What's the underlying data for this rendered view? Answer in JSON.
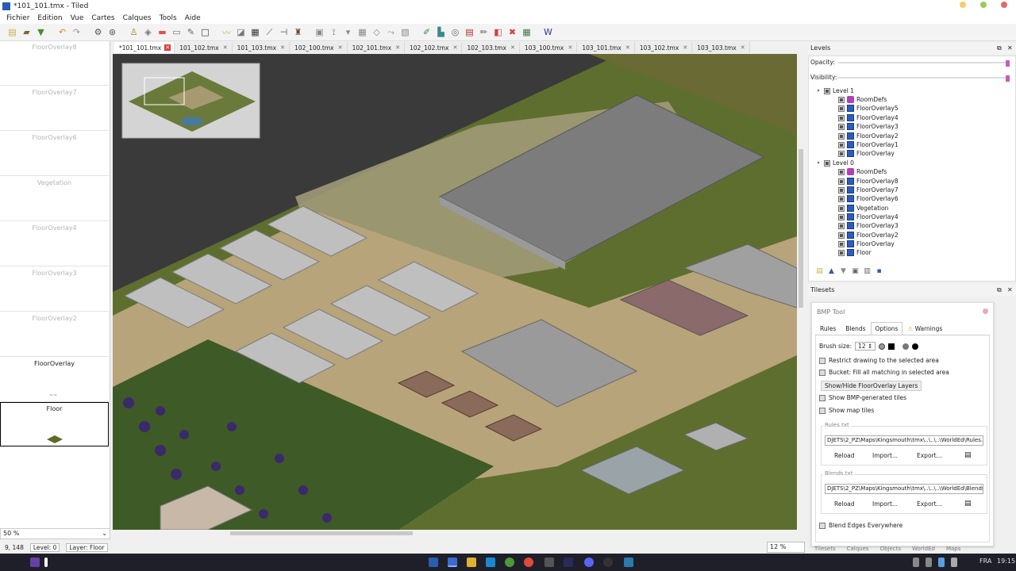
{
  "window": {
    "title": "*101_101.tmx - Tiled"
  },
  "menu": [
    "Fichier",
    "Edition",
    "Vue",
    "Cartes",
    "Calques",
    "Tools",
    "Aide"
  ],
  "left_panel": {
    "slots": [
      {
        "label": "FloorOverlay8"
      },
      {
        "label": "FloorOverlay7"
      },
      {
        "label": "FloorOverlay6"
      },
      {
        "label": "Vegetation"
      },
      {
        "label": "FloorOverlay4"
      },
      {
        "label": "FloorOverlay3"
      },
      {
        "label": "FloorOverlay2"
      },
      {
        "label": "FloorOverlay"
      },
      {
        "label": "Floor"
      }
    ],
    "zoom": "50 %"
  },
  "tabs": [
    {
      "label": "*101_101.tmx"
    },
    {
      "label": "101_102.tmx"
    },
    {
      "label": "101_103.tmx"
    },
    {
      "label": "102_100.tmx"
    },
    {
      "label": "102_101.tmx"
    },
    {
      "label": "102_102.tmx"
    },
    {
      "label": "102_103.tmx"
    },
    {
      "label": "103_100.tmx"
    },
    {
      "label": "103_101.tmx"
    },
    {
      "label": "103_102.tmx"
    },
    {
      "label": "103_103.tmx"
    }
  ],
  "status": {
    "coords": "9, 148",
    "level": "Level: 0",
    "layer": "Layer: Floor",
    "map_zoom": "12 %"
  },
  "levels_panel": {
    "title": "Levels",
    "opacity_label": "Opacity:",
    "visibility_label": "Visibility:",
    "level1": {
      "name": "Level 1",
      "layers": [
        "RoomDefs",
        "FloorOverlay5",
        "FloorOverlay4",
        "FloorOverlay3",
        "FloorOverlay2",
        "FloorOverlay1",
        "FloorOverlay"
      ]
    },
    "level0": {
      "name": "Level 0",
      "layers": [
        "RoomDefs",
        "FloorOverlay8",
        "FloorOverlay7",
        "FloorOverlay6",
        "Vegetation",
        "FloorOverlay4",
        "FloorOverlay3",
        "FloorOverlay2",
        "FloorOverlay",
        "Floor"
      ]
    }
  },
  "tilesets_panel": {
    "title": "Tilesets"
  },
  "bmp_tool": {
    "title": "BMP Tool",
    "tabs": [
      "Rules",
      "Blends",
      "Options",
      "Warnings"
    ],
    "brush_size_label": "Brush size:",
    "brush_size": "12",
    "restrict": "Restrict drawing to the selected area",
    "bucket": "Bucket: Fill all matching in selected area",
    "showhide": "Show/Hide FloorOverlay Layers",
    "show_bmp": "Show BMP-generated tiles",
    "show_map": "Show map tiles",
    "rules_group": "Rules.txt",
    "rules_path": "DJETS\\2_PZ\\Maps\\Kingsmouth\\tmx\\..\\..\\..\\WorldEd\\Rules.txt",
    "blends_group": "Blends.txt",
    "blends_path": "DJETS\\2_PZ\\Maps\\Kingsmouth\\tmx\\..\\..\\..\\WorldEd\\Blends.txt",
    "reload": "Reload",
    "import": "Import...",
    "export": "Export...",
    "blend_edges": "Blend Edges Everywhere"
  },
  "bottom_tabs": [
    "Tilesets",
    "Calques",
    "Objects",
    "WorldEd",
    "Maps"
  ],
  "taskbar": {
    "lang": "FRA",
    "time": "19:15"
  },
  "colors": {
    "accent": "#c45cbf",
    "map_bg": "#3a3a3a",
    "grass": "#5a7a30",
    "sand": "#b8a47a"
  }
}
